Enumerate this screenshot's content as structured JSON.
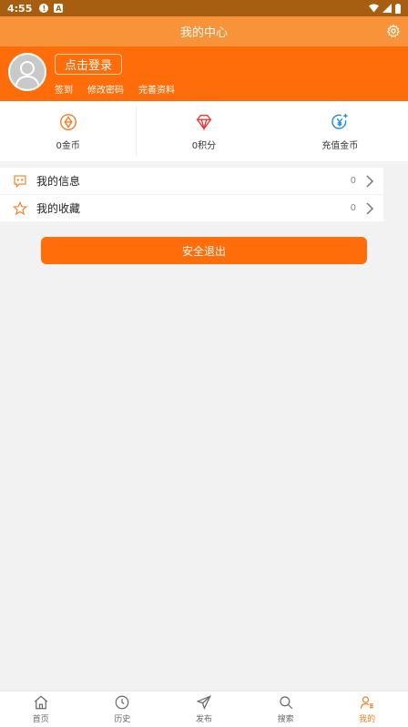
{
  "statusbar": {
    "time": "4:55",
    "icon1": "!",
    "icon2": "A"
  },
  "header": {
    "title": "我的中心",
    "settings_icon": "gear-icon"
  },
  "profile": {
    "login_label": "点击登录",
    "links": [
      "签到",
      "修改密码",
      "完善资料"
    ]
  },
  "stats": [
    {
      "label": "0金币",
      "icon": "coin-icon"
    },
    {
      "label": "0积分",
      "icon": "diamond-icon"
    },
    {
      "label": "充值金币",
      "icon": "recharge-icon"
    }
  ],
  "menu": [
    {
      "label": "我的信息",
      "count": "0",
      "icon": "message-icon"
    },
    {
      "label": "我的收藏",
      "count": "0",
      "icon": "star-icon"
    }
  ],
  "logout_label": "安全退出",
  "tabs": [
    {
      "label": "首页",
      "icon": "home-icon"
    },
    {
      "label": "历史",
      "icon": "clock-icon"
    },
    {
      "label": "发布",
      "icon": "send-icon"
    },
    {
      "label": "搜索",
      "icon": "search-icon"
    },
    {
      "label": "我的",
      "icon": "user-icon"
    }
  ],
  "colors": {
    "accent": "#ff6d0a",
    "title_bar": "#f8933a",
    "status_bar": "#a85e10",
    "active_tab": "#f57c1f"
  }
}
